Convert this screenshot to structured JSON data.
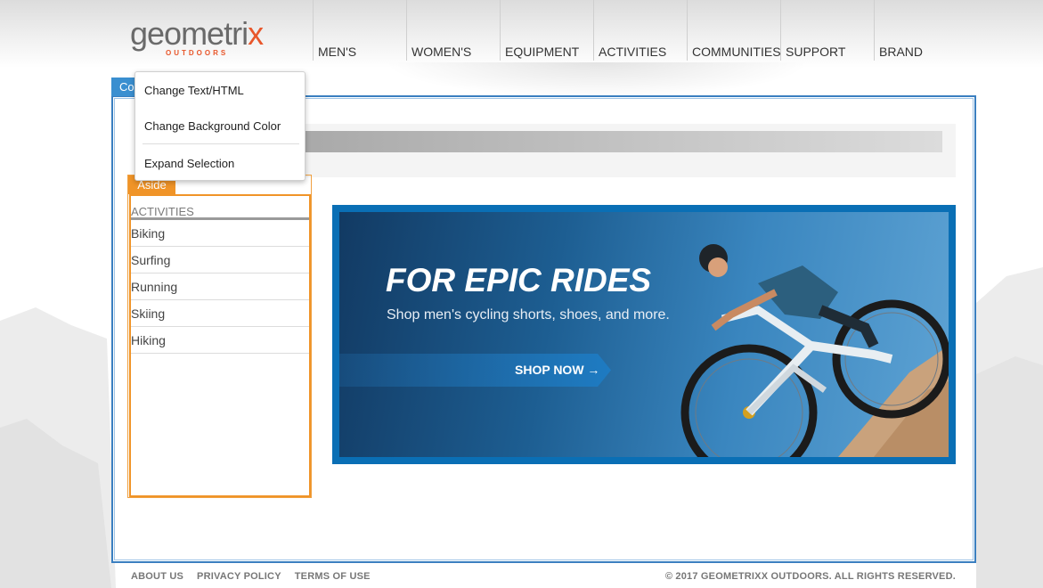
{
  "logo": {
    "text_main": "geometri",
    "text_x": "x",
    "text_sub": "OUTDOORS"
  },
  "nav": [
    "MEN'S",
    "WOMEN'S",
    "EQUIPMENT",
    "ACTIVITIES",
    "COMMUNITIES",
    "SUPPORT",
    "BRAND"
  ],
  "container": {
    "tab_label": "Co"
  },
  "context_menu": {
    "items": [
      "Change Text/HTML",
      "Change Background Color",
      "Expand Selection"
    ]
  },
  "aside": {
    "label": "Aside",
    "heading": "ACTIVITIES",
    "items": [
      "Biking",
      "Surfing",
      "Running",
      "Skiing",
      "Hiking"
    ]
  },
  "hero": {
    "title": "FOR EPIC RIDES",
    "subtitle": "Shop men's cycling shorts, shoes, and more.",
    "cta": "SHOP NOW →"
  },
  "footer": {
    "links": [
      "ABOUT US",
      "PRIVACY POLICY",
      "TERMS OF USE"
    ],
    "copyright": "© 2017 GEOMETRIXX OUTDOORS. ALL RIGHTS RESERVED."
  },
  "colors": {
    "accent_orange": "#f09428",
    "selection_blue": "#3a8fd0",
    "hero_frame": "#0a6fb5"
  }
}
